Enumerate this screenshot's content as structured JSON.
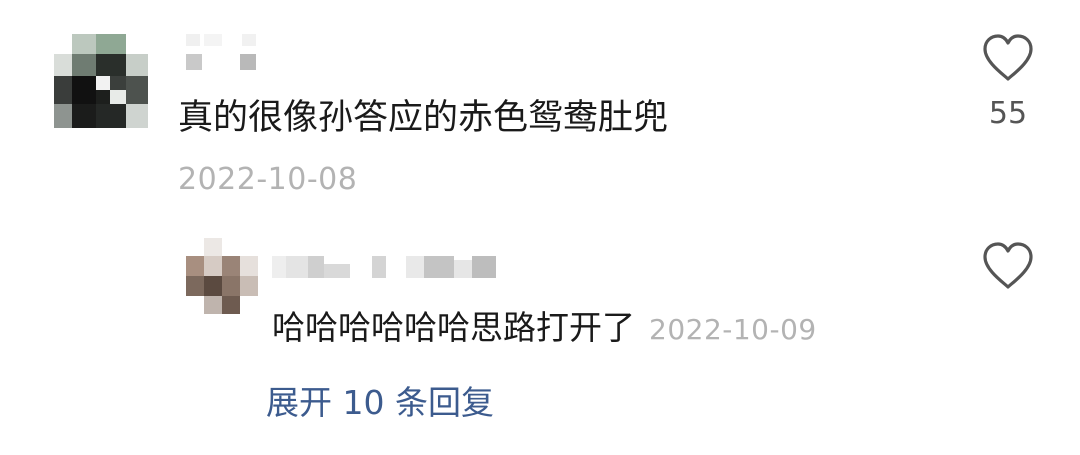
{
  "comment": {
    "text": "真的很像孙答应的赤色鸳鸯肚兜",
    "date": "2022-10-08",
    "like_count": "55",
    "like_icon": "heart-outline-icon"
  },
  "reply": {
    "text": "哈哈哈哈哈哈思路打开了",
    "date": "2022-10-09",
    "like_icon": "heart-outline-icon"
  },
  "expand_replies_label": "展开 10 条回复",
  "colors": {
    "text": "#1a1a1a",
    "meta": "#b3b3b3",
    "link": "#3c5b8e",
    "icon": "#555555"
  }
}
